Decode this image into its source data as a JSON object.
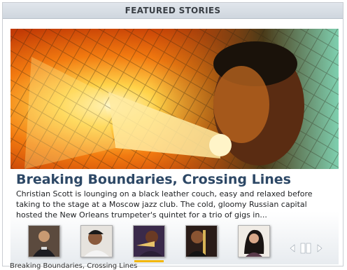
{
  "header": {
    "title": "FEATURED STORIES"
  },
  "story": {
    "headline": "Breaking Boundaries, Crossing Lines",
    "summary": "Christian Scott is lounging on a black leather couch, easy and relaxed before taking to the stage at a Moscow jazz club. The cold, gloomy Russian capital hosted the New Orleans trumpeter's quintet for a trio of gigs in..."
  },
  "thumbnails": [
    {
      "icon": "person-at-podium-photo",
      "active": false
    },
    {
      "icon": "person-portrait-photo",
      "active": false
    },
    {
      "icon": "trumpeter-photo",
      "active": true
    },
    {
      "icon": "trombonist-photo",
      "active": false
    },
    {
      "icon": "singer-photo",
      "active": false
    }
  ],
  "controls": [
    "previous-arrow",
    "pause",
    "next-arrow"
  ],
  "caption": "Breaking Boundaries, Crossing Lines",
  "colors": {
    "header_bg": "#d5dbe2",
    "headline": "#2d4866",
    "active_indicator": "#f2b80c"
  }
}
